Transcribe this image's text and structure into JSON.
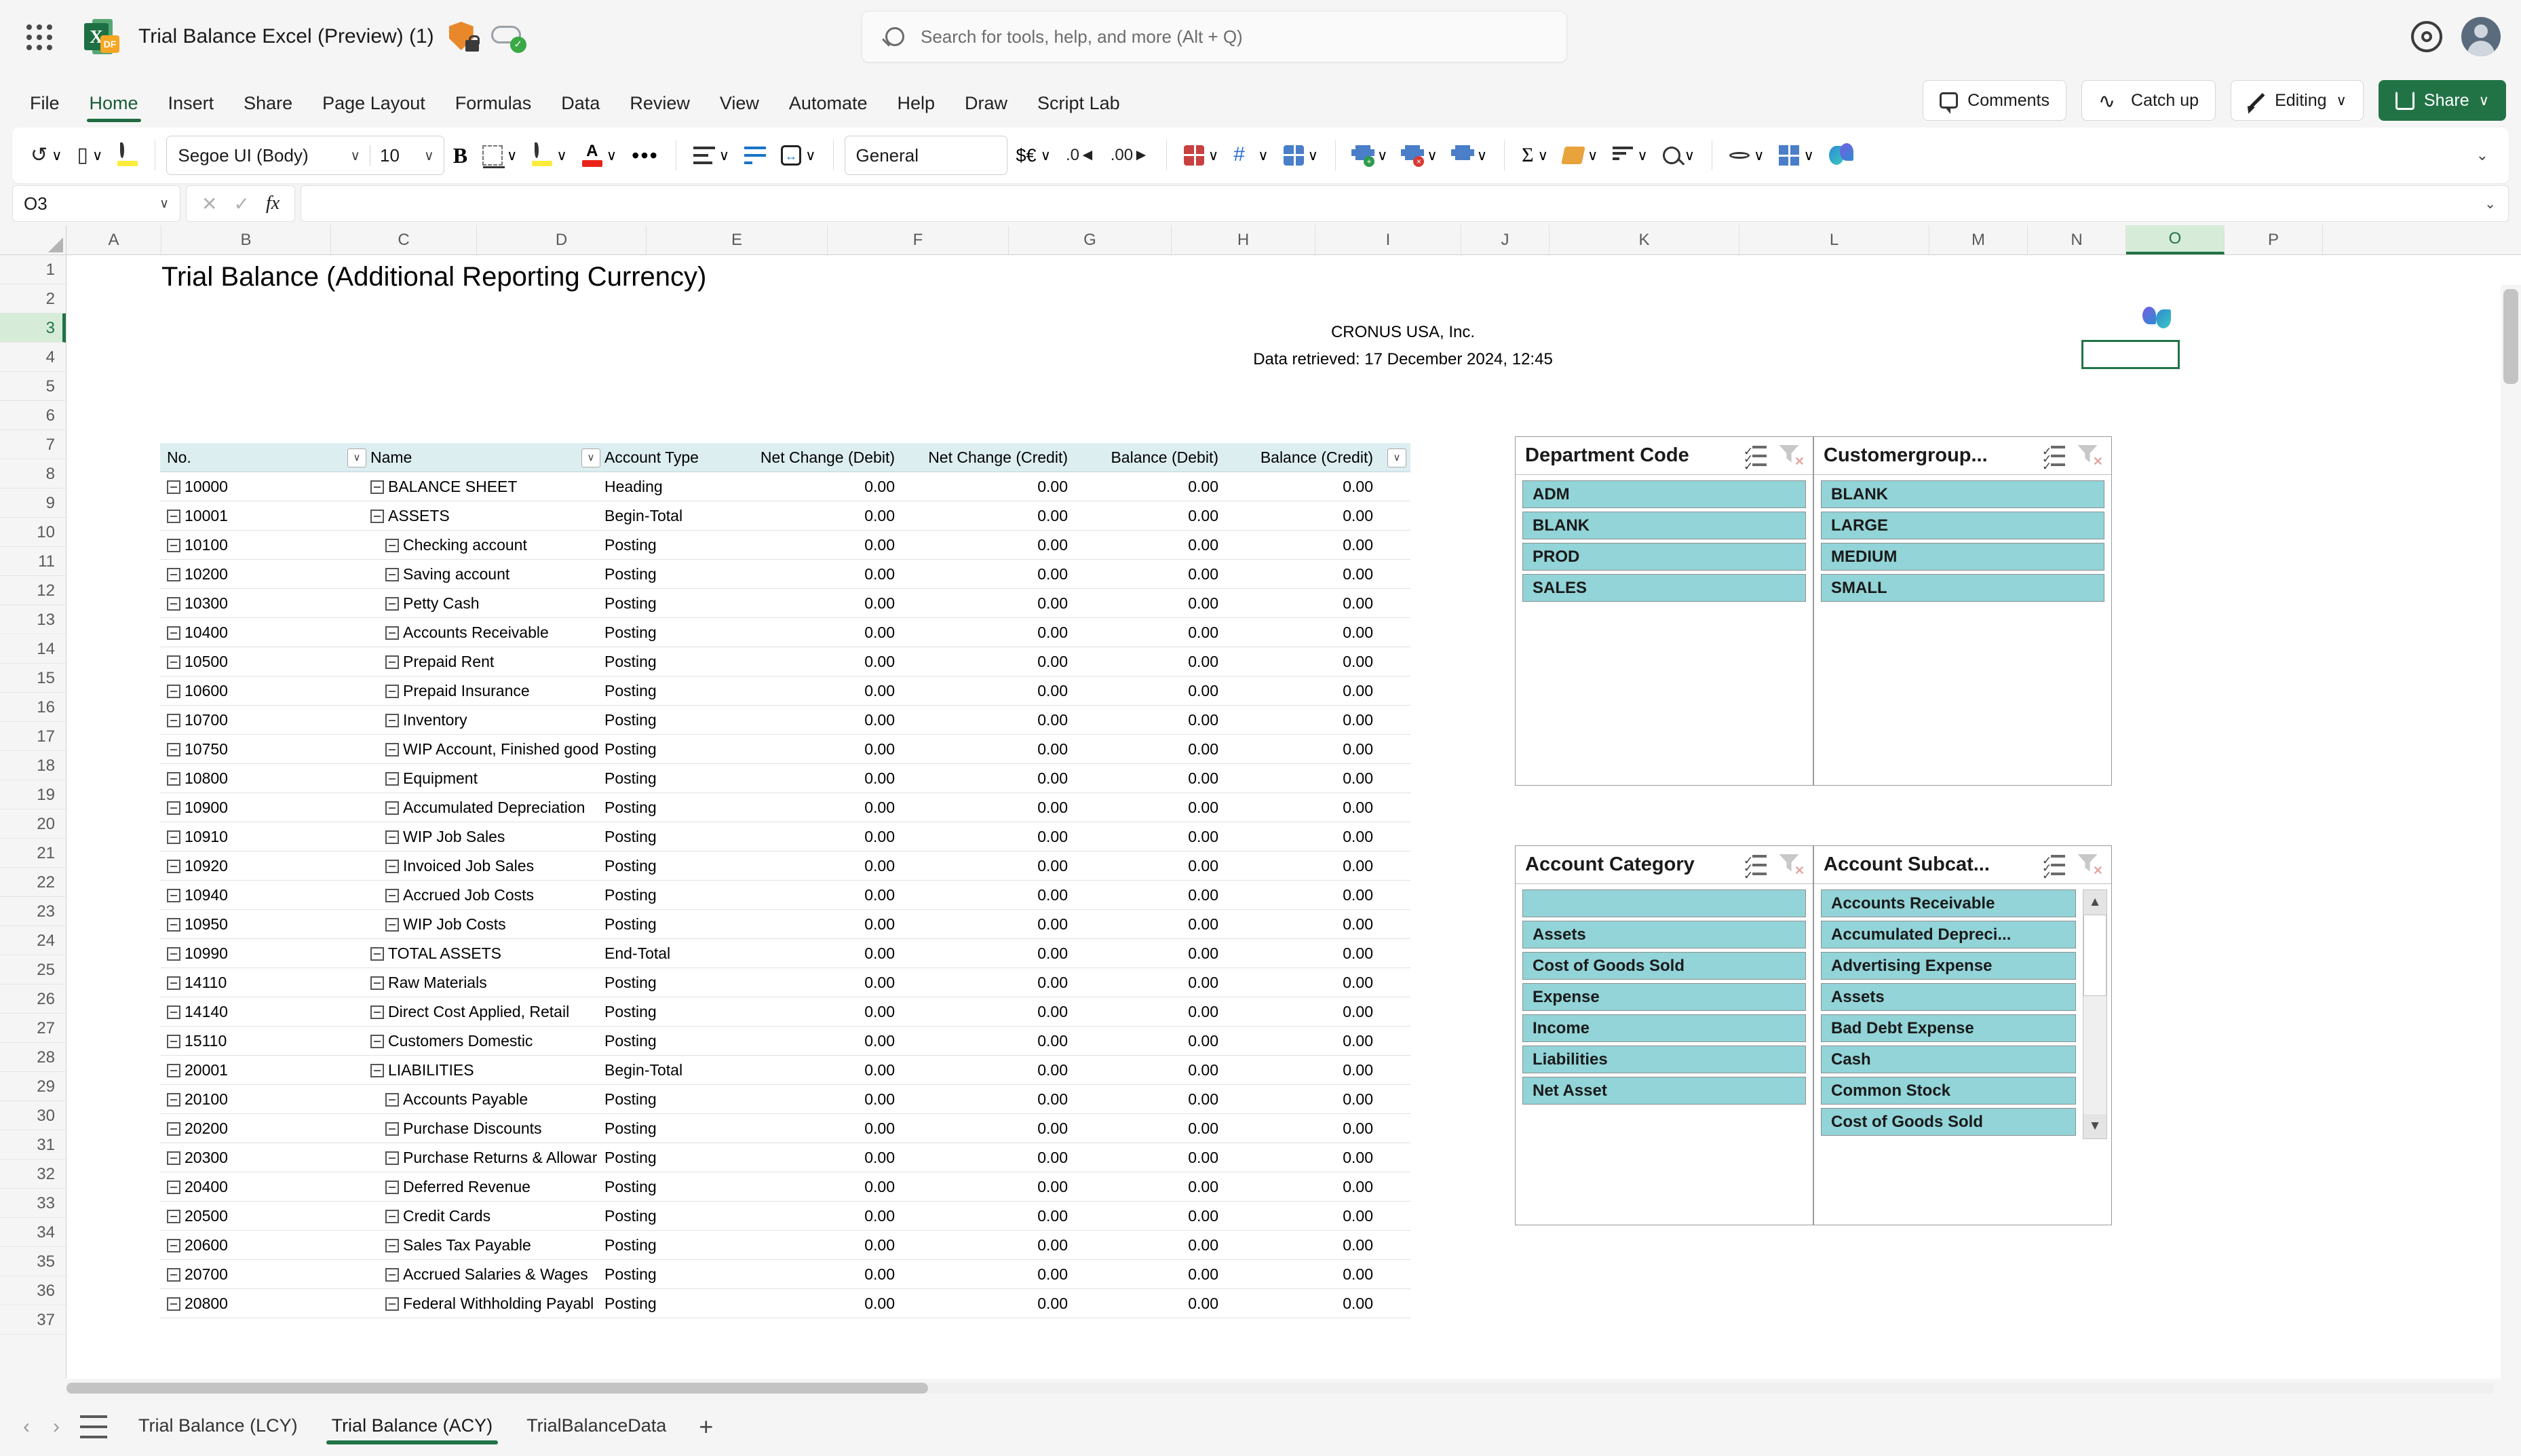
{
  "titlebar": {
    "doc_title": "Trial Balance Excel (Preview) (1)",
    "search_placeholder": "Search for tools, help, and more (Alt + Q)",
    "icons": [
      "app-launcher",
      "excel-file-icon",
      "protected-shield-icon",
      "cloud-saved-icon",
      "settings-gear-icon",
      "account-avatar"
    ]
  },
  "ribbon": {
    "tabs": [
      "File",
      "Home",
      "Insert",
      "Share",
      "Page Layout",
      "Formulas",
      "Data",
      "Review",
      "View",
      "Automate",
      "Help",
      "Draw",
      "Script Lab"
    ],
    "active_tab": "Home",
    "right_buttons": [
      {
        "label": "Comments"
      },
      {
        "label": "Catch up"
      },
      {
        "label": "Editing"
      },
      {
        "label": "Share"
      }
    ]
  },
  "format_toolbar": {
    "font_name": "Segoe UI (Body)",
    "font_size": "10",
    "number_format": "General",
    "bold_label": "B",
    "collapse_label": "⌄"
  },
  "formula_bar": {
    "name_box": "O3",
    "cancel": "✕",
    "confirm": "✓",
    "fx": "fx",
    "formula_value": "",
    "expand": "⌄"
  },
  "grid": {
    "columns": [
      "A",
      "B",
      "C",
      "D",
      "E",
      "F",
      "G",
      "H",
      "I",
      "J",
      "K",
      "L",
      "M",
      "N",
      "O",
      "P"
    ],
    "selected_column": "O",
    "selected_row": 3,
    "rows": [
      1,
      2,
      3,
      4,
      5,
      6,
      7,
      8,
      9,
      10,
      11,
      12,
      13,
      14,
      15,
      16,
      17,
      18,
      19,
      20,
      21,
      22,
      23,
      24,
      25,
      26,
      27,
      28,
      29,
      30,
      31,
      32,
      33,
      34,
      35,
      36,
      37
    ]
  },
  "report": {
    "title": "Trial Balance (Additional Reporting Currency)",
    "company": "CRONUS USA, Inc.",
    "retrieved": "Data retrieved: 17 December 2024, 12:45"
  },
  "table": {
    "headers": [
      "No.",
      "Name",
      "Account Type",
      "Net Change (Debit)",
      "Net Change (Credit)",
      "Balance (Debit)",
      "Balance (Credit)"
    ],
    "rows": [
      {
        "no": "10000",
        "name": "BALANCE SHEET",
        "indent": 0,
        "type": "Heading",
        "nc_debit": "0.00",
        "nc_credit": "0.00",
        "bal_debit": "0.00",
        "bal_credit": "0.00"
      },
      {
        "no": "10001",
        "name": "ASSETS",
        "indent": 0,
        "type": "Begin-Total",
        "nc_debit": "0.00",
        "nc_credit": "0.00",
        "bal_debit": "0.00",
        "bal_credit": "0.00"
      },
      {
        "no": "10100",
        "name": "Checking account",
        "indent": 1,
        "type": "Posting",
        "nc_debit": "0.00",
        "nc_credit": "0.00",
        "bal_debit": "0.00",
        "bal_credit": "0.00"
      },
      {
        "no": "10200",
        "name": "Saving account",
        "indent": 1,
        "type": "Posting",
        "nc_debit": "0.00",
        "nc_credit": "0.00",
        "bal_debit": "0.00",
        "bal_credit": "0.00"
      },
      {
        "no": "10300",
        "name": "Petty Cash",
        "indent": 1,
        "type": "Posting",
        "nc_debit": "0.00",
        "nc_credit": "0.00",
        "bal_debit": "0.00",
        "bal_credit": "0.00"
      },
      {
        "no": "10400",
        "name": "Accounts Receivable",
        "indent": 1,
        "type": "Posting",
        "nc_debit": "0.00",
        "nc_credit": "0.00",
        "bal_debit": "0.00",
        "bal_credit": "0.00"
      },
      {
        "no": "10500",
        "name": "Prepaid Rent",
        "indent": 1,
        "type": "Posting",
        "nc_debit": "0.00",
        "nc_credit": "0.00",
        "bal_debit": "0.00",
        "bal_credit": "0.00"
      },
      {
        "no": "10600",
        "name": "Prepaid Insurance",
        "indent": 1,
        "type": "Posting",
        "nc_debit": "0.00",
        "nc_credit": "0.00",
        "bal_debit": "0.00",
        "bal_credit": "0.00"
      },
      {
        "no": "10700",
        "name": "Inventory",
        "indent": 1,
        "type": "Posting",
        "nc_debit": "0.00",
        "nc_credit": "0.00",
        "bal_debit": "0.00",
        "bal_credit": "0.00"
      },
      {
        "no": "10750",
        "name": "WIP Account, Finished good",
        "indent": 1,
        "type": "Posting",
        "nc_debit": "0.00",
        "nc_credit": "0.00",
        "bal_debit": "0.00",
        "bal_credit": "0.00"
      },
      {
        "no": "10800",
        "name": "Equipment",
        "indent": 1,
        "type": "Posting",
        "nc_debit": "0.00",
        "nc_credit": "0.00",
        "bal_debit": "0.00",
        "bal_credit": "0.00"
      },
      {
        "no": "10900",
        "name": "Accumulated Depreciation",
        "indent": 1,
        "type": "Posting",
        "nc_debit": "0.00",
        "nc_credit": "0.00",
        "bal_debit": "0.00",
        "bal_credit": "0.00"
      },
      {
        "no": "10910",
        "name": "WIP Job Sales",
        "indent": 1,
        "type": "Posting",
        "nc_debit": "0.00",
        "nc_credit": "0.00",
        "bal_debit": "0.00",
        "bal_credit": "0.00"
      },
      {
        "no": "10920",
        "name": "Invoiced Job Sales",
        "indent": 1,
        "type": "Posting",
        "nc_debit": "0.00",
        "nc_credit": "0.00",
        "bal_debit": "0.00",
        "bal_credit": "0.00"
      },
      {
        "no": "10940",
        "name": "Accrued Job Costs",
        "indent": 1,
        "type": "Posting",
        "nc_debit": "0.00",
        "nc_credit": "0.00",
        "bal_debit": "0.00",
        "bal_credit": "0.00"
      },
      {
        "no": "10950",
        "name": "WIP Job Costs",
        "indent": 1,
        "type": "Posting",
        "nc_debit": "0.00",
        "nc_credit": "0.00",
        "bal_debit": "0.00",
        "bal_credit": "0.00"
      },
      {
        "no": "10990",
        "name": "TOTAL ASSETS",
        "indent": 0,
        "type": "End-Total",
        "nc_debit": "0.00",
        "nc_credit": "0.00",
        "bal_debit": "0.00",
        "bal_credit": "0.00"
      },
      {
        "no": "14110",
        "name": "Raw Materials",
        "indent": 0,
        "type": "Posting",
        "nc_debit": "0.00",
        "nc_credit": "0.00",
        "bal_debit": "0.00",
        "bal_credit": "0.00"
      },
      {
        "no": "14140",
        "name": "Direct Cost Applied, Retail",
        "indent": 0,
        "type": "Posting",
        "nc_debit": "0.00",
        "nc_credit": "0.00",
        "bal_debit": "0.00",
        "bal_credit": "0.00"
      },
      {
        "no": "15110",
        "name": "Customers Domestic",
        "indent": 0,
        "type": "Posting",
        "nc_debit": "0.00",
        "nc_credit": "0.00",
        "bal_debit": "0.00",
        "bal_credit": "0.00"
      },
      {
        "no": "20001",
        "name": "LIABILITIES",
        "indent": 0,
        "type": "Begin-Total",
        "nc_debit": "0.00",
        "nc_credit": "0.00",
        "bal_debit": "0.00",
        "bal_credit": "0.00"
      },
      {
        "no": "20100",
        "name": "Accounts Payable",
        "indent": 1,
        "type": "Posting",
        "nc_debit": "0.00",
        "nc_credit": "0.00",
        "bal_debit": "0.00",
        "bal_credit": "0.00"
      },
      {
        "no": "20200",
        "name": "Purchase Discounts",
        "indent": 1,
        "type": "Posting",
        "nc_debit": "0.00",
        "nc_credit": "0.00",
        "bal_debit": "0.00",
        "bal_credit": "0.00"
      },
      {
        "no": "20300",
        "name": "Purchase Returns & Allowar",
        "indent": 1,
        "type": "Posting",
        "nc_debit": "0.00",
        "nc_credit": "0.00",
        "bal_debit": "0.00",
        "bal_credit": "0.00"
      },
      {
        "no": "20400",
        "name": "Deferred Revenue",
        "indent": 1,
        "type": "Posting",
        "nc_debit": "0.00",
        "nc_credit": "0.00",
        "bal_debit": "0.00",
        "bal_credit": "0.00"
      },
      {
        "no": "20500",
        "name": "Credit Cards",
        "indent": 1,
        "type": "Posting",
        "nc_debit": "0.00",
        "nc_credit": "0.00",
        "bal_debit": "0.00",
        "bal_credit": "0.00"
      },
      {
        "no": "20600",
        "name": "Sales Tax Payable",
        "indent": 1,
        "type": "Posting",
        "nc_debit": "0.00",
        "nc_credit": "0.00",
        "bal_debit": "0.00",
        "bal_credit": "0.00"
      },
      {
        "no": "20700",
        "name": "Accrued Salaries & Wages",
        "indent": 1,
        "type": "Posting",
        "nc_debit": "0.00",
        "nc_credit": "0.00",
        "bal_debit": "0.00",
        "bal_credit": "0.00"
      },
      {
        "no": "20800",
        "name": "Federal Withholding Payabl",
        "indent": 1,
        "type": "Posting",
        "nc_debit": "0.00",
        "nc_credit": "0.00",
        "bal_debit": "0.00",
        "bal_credit": "0.00"
      }
    ]
  },
  "slicers": [
    {
      "title": "Department Code",
      "items": [
        "ADM",
        "BLANK",
        "PROD",
        "SALES"
      ],
      "has_scrollbar": false
    },
    {
      "title": "Customergroup...",
      "items": [
        "BLANK",
        "LARGE",
        "MEDIUM",
        "SMALL"
      ],
      "has_scrollbar": false
    },
    {
      "title": "Account Category",
      "items": [
        "",
        "Assets",
        "Cost of Goods Sold",
        "Expense",
        "Income",
        "Liabilities",
        "Net Asset"
      ],
      "has_scrollbar": false
    },
    {
      "title": "Account Subcat...",
      "items": [
        "Accounts Receivable",
        "Accumulated Depreci...",
        "Advertising Expense",
        "Assets",
        "Bad Debt Expense",
        "Cash",
        "Common Stock",
        "Cost of Goods Sold"
      ],
      "has_scrollbar": true,
      "scroll_up": "▲",
      "scroll_down": "▼"
    }
  ],
  "sheet_tabs": {
    "prev": "‹",
    "next": "›",
    "tabs": [
      "Trial Balance (LCY)",
      "Trial Balance (ACY)",
      "TrialBalanceData"
    ],
    "active": "Trial Balance (ACY)",
    "add_label": "+"
  },
  "colors": {
    "accent_green": "#217346",
    "slicer_fill": "#92d4d8",
    "table_header": "#ddeef1",
    "selection_green": "#d6ecd9"
  }
}
